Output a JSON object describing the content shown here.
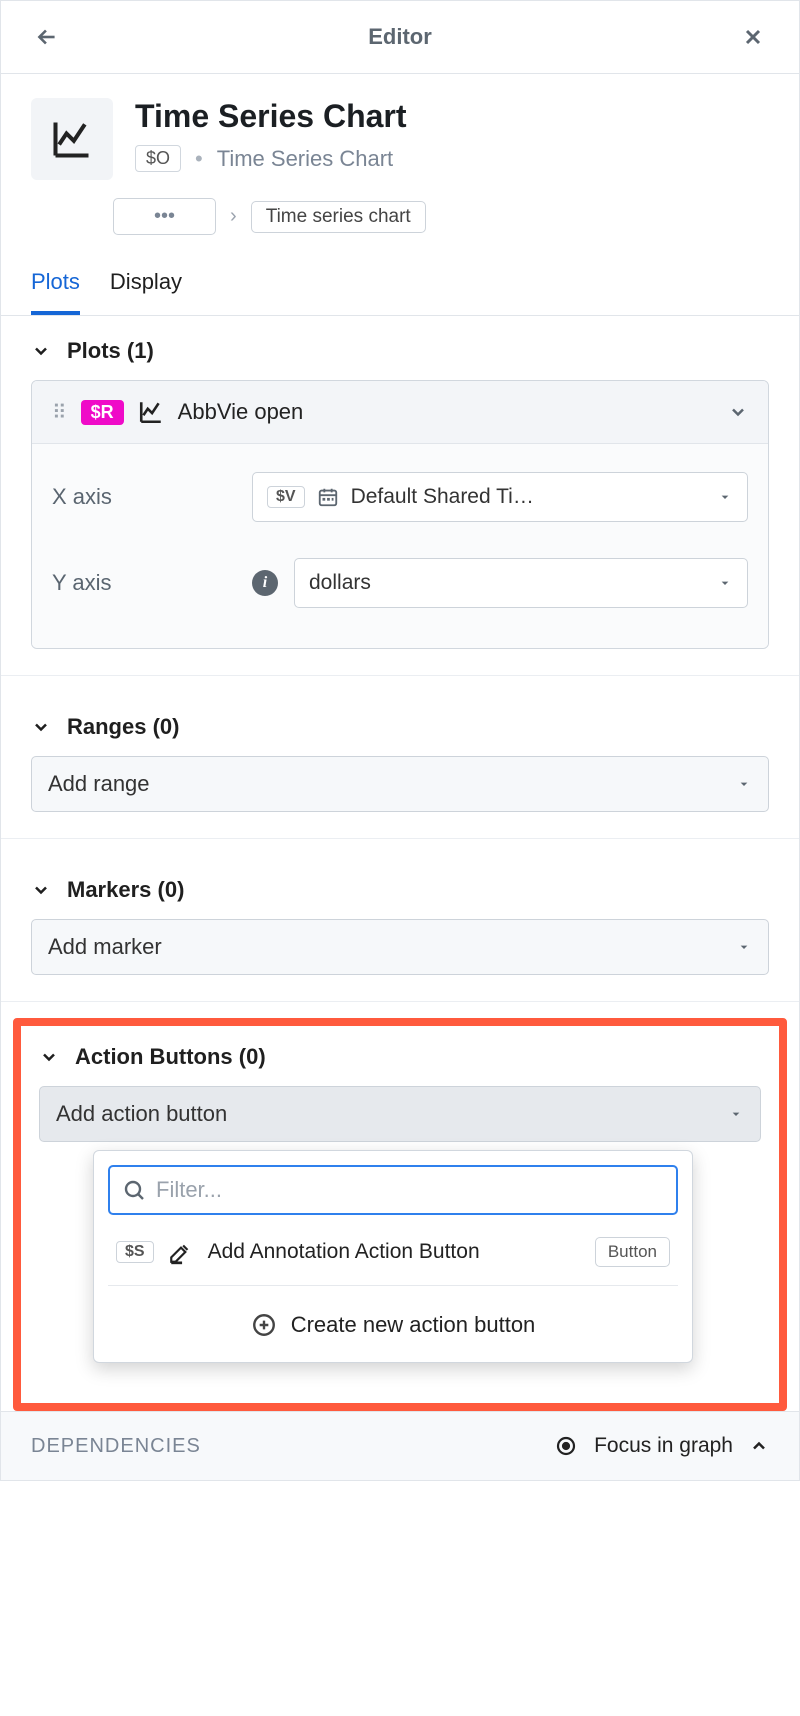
{
  "header": {
    "title": "Editor"
  },
  "title": {
    "heading": "Time Series Chart",
    "tag": "$O",
    "subtitle": "Time Series Chart",
    "breadcrumb_dots": "•••",
    "breadcrumb_current": "Time series chart"
  },
  "tabs": {
    "plots": "Plots",
    "display": "Display"
  },
  "sections": {
    "plots": {
      "header": "Plots (1)",
      "item": {
        "tag": "$R",
        "label": "AbbVie open",
        "xaxis_label": "X axis",
        "xaxis_tag": "$V",
        "xaxis_value": "Default Shared Ti…",
        "yaxis_label": "Y axis",
        "yaxis_value": "dollars"
      }
    },
    "ranges": {
      "header": "Ranges (0)",
      "placeholder": "Add range"
    },
    "markers": {
      "header": "Markers (0)",
      "placeholder": "Add marker"
    },
    "actions": {
      "header": "Action Buttons (0)",
      "placeholder": "Add action button",
      "filter_placeholder": "Filter...",
      "option_tag": "$S",
      "option_label": "Add Annotation Action Button",
      "option_badge": "Button",
      "create_label": "Create new action button"
    }
  },
  "footer": {
    "deps": "DEPENDENCIES",
    "focus": "Focus in graph"
  }
}
